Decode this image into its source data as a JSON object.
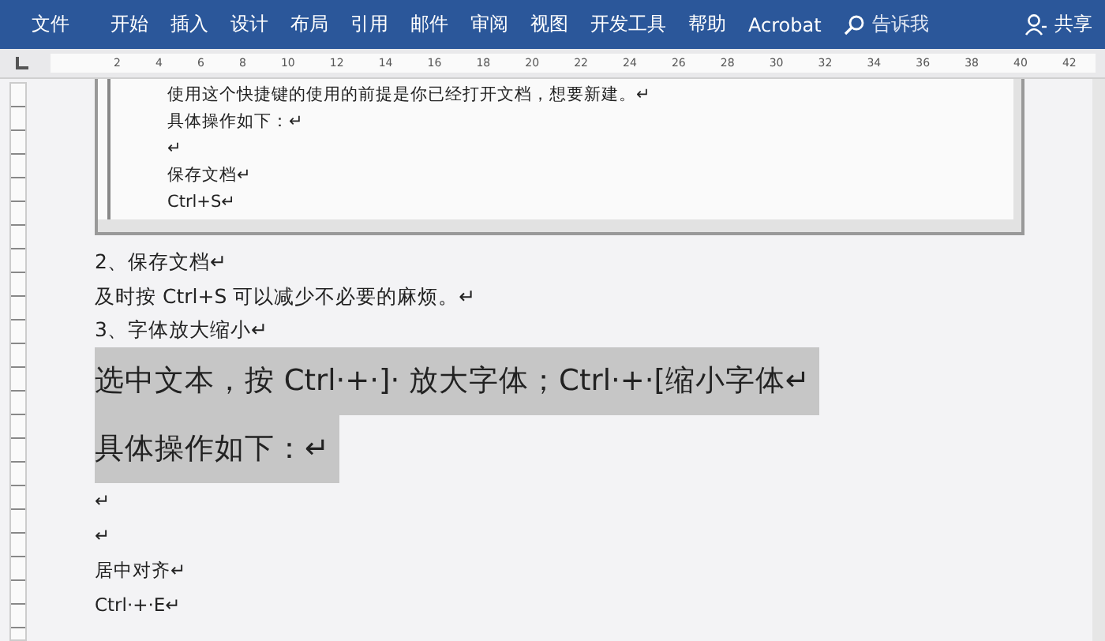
{
  "menu": [
    {
      "label": "文件",
      "kind": "file"
    },
    {
      "label": "开始",
      "kind": "tab"
    },
    {
      "label": "插入",
      "kind": "tab"
    },
    {
      "label": "设计",
      "kind": "tab"
    },
    {
      "label": "布局",
      "kind": "tab"
    },
    {
      "label": "引用",
      "kind": "tab"
    },
    {
      "label": "邮件",
      "kind": "tab"
    },
    {
      "label": "审阅",
      "kind": "tab"
    },
    {
      "label": "视图",
      "kind": "tab"
    },
    {
      "label": "开发工具",
      "kind": "tab"
    },
    {
      "label": "帮助",
      "kind": "tab"
    },
    {
      "label": "Acrobat",
      "kind": "tab"
    },
    {
      "label": "告诉我",
      "kind": "search"
    },
    {
      "label": "共享",
      "kind": "share"
    }
  ],
  "ruler": {
    "ticks": [
      "2",
      "4",
      "6",
      "8",
      "10",
      "12",
      "14",
      "16",
      "18",
      "20",
      "22",
      "24",
      "26",
      "28",
      "30",
      "32",
      "34",
      "36",
      "38",
      "40",
      "42"
    ]
  },
  "embedded": {
    "lines": [
      "使用这个快捷键的使用的前提是你已经打开文档，想要新建。↵",
      "具体操作如下：↵",
      "↵",
      "保存文档↵",
      "Ctrl+S↵"
    ]
  },
  "paragraphs": [
    {
      "text": "2、保存文档↵",
      "kind": "normal",
      "selected": false
    },
    {
      "text": "及时按 Ctrl+S 可以减少不必要的麻烦。↵",
      "kind": "normal",
      "selected": false
    },
    {
      "text": "3、字体放大缩小↵",
      "kind": "normal",
      "selected": false
    },
    {
      "text": "选中文本，按 Ctrl·+·]· 放大字体；Ctrl·+·[缩小字体↵",
      "kind": "large",
      "selected": true
    },
    {
      "text": "具体操作如下：↵",
      "kind": "large",
      "selected": true
    },
    {
      "text": "↵",
      "kind": "small",
      "selected": false
    },
    {
      "text": "↵",
      "kind": "small",
      "selected": false
    },
    {
      "text": "居中对齐↵",
      "kind": "small",
      "selected": false
    },
    {
      "text": "Ctrl·+·E↵",
      "kind": "small",
      "selected": false
    }
  ]
}
